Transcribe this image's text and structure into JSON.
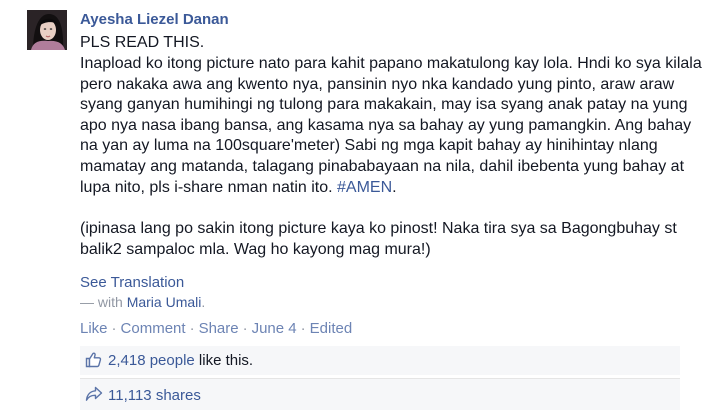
{
  "post": {
    "author": "Ayesha Liezel Danan",
    "heading": "PLS READ THIS.",
    "body": [
      {
        "text": "Inapload ko itong picture nato para kahit papano makatulong kay lola. Hndi ko sya kilala pero nakaka awa ang kwento nya, pansinin nyo nka kandado yung pinto, araw araw syang ganyan humihingi ng tulong para makakain, may isa syang anak patay na yung apo nya nasa ibang bansa, ang kasama nya sa bahay ay yung pamangkin. Ang bahay na yan ay luma na 100square'meter) Sabi ng mga kapit bahay ay hinihintay nlang mamatay ang matanda, talagang pinababayaan na nila, dahil ibebenta yung bahay at lupa nito, pls i-share nman natin ito. ",
        "hashtag": "#AMEN",
        "after": "."
      },
      {
        "text": "(ipinasa lang po sakin itong picture kaya ko pinost! Naka tira sya sa Bagongbuhay st balik2 sampaloc mla. Wag ho kayong mag mura!)"
      }
    ],
    "see_translation": "See Translation",
    "with_prefix": "— with ",
    "tagged_person": "Maria Umali",
    "with_suffix": ".",
    "actions": {
      "like": "Like",
      "comment": "Comment",
      "share": "Share",
      "date": "June 4",
      "edited": "Edited",
      "separator": "·"
    },
    "likes": {
      "count": "2,418 people",
      "suffix": " like this."
    },
    "shares": {
      "count": "11,113 shares"
    }
  },
  "colors": {
    "link": "#3b5998",
    "text": "#141823",
    "muted": "#9197a3",
    "panel": "#f6f7f9"
  },
  "icons": {
    "likes": "thumbs-up-icon",
    "shares": "share-arrow-icon"
  }
}
